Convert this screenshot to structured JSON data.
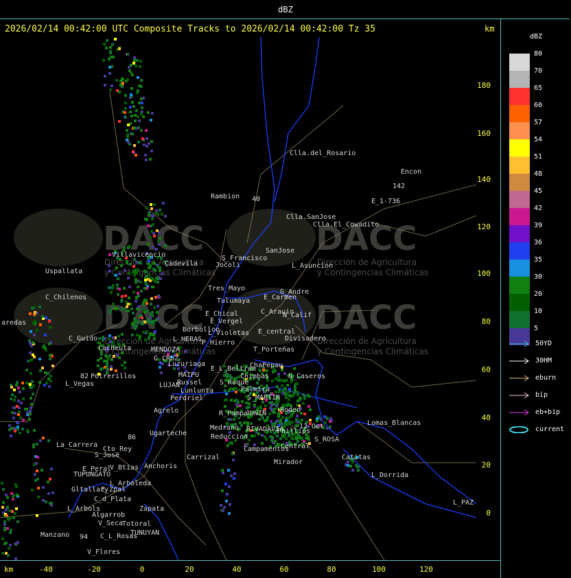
{
  "header": {
    "unit_label": "dBZ"
  },
  "title": "2026/02/14 00:42:00 UTC Composite Tracks to 2026/02/14 00:42:00 Tz 35",
  "axis": {
    "km_label_top": "km",
    "km_label_bottom": "km",
    "y_ticks": [
      "180",
      "160",
      "140",
      "120",
      "100",
      "80",
      "60",
      "40",
      "20",
      "0"
    ],
    "x_ticks": [
      "-40",
      "-20",
      "0",
      "20",
      "40",
      "60",
      "80",
      "100",
      "120"
    ]
  },
  "legend": {
    "title": "dBZ",
    "scale": [
      {
        "label": "80",
        "color": "#d8d8d8"
      },
      {
        "label": "70",
        "color": "#b4b4b4"
      },
      {
        "label": "65",
        "color": "#ff3030"
      },
      {
        "label": "60",
        "color": "#ff6000"
      },
      {
        "label": "57",
        "color": "#ff9050"
      },
      {
        "label": "54",
        "color": "#ffff00"
      },
      {
        "label": "51",
        "color": "#ffc030"
      },
      {
        "label": "48",
        "color": "#d08a40"
      },
      {
        "label": "45",
        "color": "#c06890"
      },
      {
        "label": "42",
        "color": "#cc1890"
      },
      {
        "label": "39",
        "color": "#7010c8"
      },
      {
        "label": "36",
        "color": "#2040f0"
      },
      {
        "label": "35",
        "color": "#1890e0"
      },
      {
        "label": "30",
        "color": "#108010"
      },
      {
        "label": "20",
        "color": "#006000"
      },
      {
        "label": "10",
        "color": "#107030"
      },
      {
        "label": "5",
        "color": "#483898"
      }
    ],
    "tracks": [
      {
        "label": "50YD",
        "color": "#40c8d0"
      },
      {
        "label": "30HM",
        "color": "#ffffff"
      },
      {
        "label": "eburn",
        "color": "#f0c080"
      },
      {
        "label": "bip",
        "color": "#f8c8d0"
      },
      {
        "label": "eb+bip",
        "color": "#e040e0"
      },
      {
        "label": "current",
        "color": "#40e0f0"
      }
    ]
  },
  "watermark": {
    "brand": "DACC",
    "line1": "Dirección de Agricultura",
    "line2": "y Contingencias Climáticas"
  },
  "places": [
    {
      "name": "Clla.del_Rosario"
    },
    {
      "name": "Encon"
    },
    {
      "name": "142"
    },
    {
      "name": "E_1-736"
    },
    {
      "name": "Rambion"
    },
    {
      "name": "Clla.SanJose"
    },
    {
      "name": "Clla.El_Cowadito"
    },
    {
      "name": "S_Francisco"
    },
    {
      "name": "SanJose"
    },
    {
      "name": "Villavicencio"
    },
    {
      "name": "Cadevila"
    },
    {
      "name": "Jocoli"
    },
    {
      "name": "L_Asuncion"
    },
    {
      "name": "Uspallata"
    },
    {
      "name": "Tres_Mayo"
    },
    {
      "name": "G_Andre"
    },
    {
      "name": "Tulumaya"
    },
    {
      "name": "E_Carmen"
    },
    {
      "name": "C_Chilenos"
    },
    {
      "name": "E_Chical"
    },
    {
      "name": "C_Arauio"
    },
    {
      "name": "N_Calif"
    },
    {
      "name": "E_Vergel"
    },
    {
      "name": "aredas"
    },
    {
      "name": "L_Violetas"
    },
    {
      "name": "E_central"
    },
    {
      "name": "Divisadero"
    },
    {
      "name": "Borbollon"
    },
    {
      "name": "C_Guido"
    },
    {
      "name": "L_HERAS"
    },
    {
      "name": "P_Hierro"
    },
    {
      "name": "Cacheuta"
    },
    {
      "name": "MENDOZA"
    },
    {
      "name": "T_Porteñas"
    },
    {
      "name": "G_CRUZ"
    },
    {
      "name": "Luzuriaga"
    },
    {
      "name": "E_L_Beltran"
    },
    {
      "name": "ChaPepau"
    },
    {
      "name": "Potrerillos"
    },
    {
      "name": "MAIPU"
    },
    {
      "name": "Chimbas"
    },
    {
      "name": "N_Caseros"
    },
    {
      "name": "L_Vegas"
    },
    {
      "name": "Russel"
    },
    {
      "name": "S_Roque"
    },
    {
      "name": "LUJAN"
    },
    {
      "name": "Lunlunta"
    },
    {
      "name": "Palmira"
    },
    {
      "name": "Perdriel"
    },
    {
      "name": "S_MARTIN"
    },
    {
      "name": "Agrelo"
    },
    {
      "name": "R_Pampa"
    },
    {
      "name": "JUNIN"
    },
    {
      "name": "Rodeo"
    },
    {
      "name": "Lomas_Blancas"
    },
    {
      "name": "Ugarteche"
    },
    {
      "name": "12_Oct"
    },
    {
      "name": "Medrano"
    },
    {
      "name": "RIVADAVIA"
    },
    {
      "name": "Phillips"
    },
    {
      "name": "Reduccion"
    },
    {
      "name": "S_ROSA"
    },
    {
      "name": "La_Carrera"
    },
    {
      "name": "Cto_Rey"
    },
    {
      "name": "Campamentos"
    },
    {
      "name": "Central"
    },
    {
      "name": "S_Jose"
    },
    {
      "name": "Carrizal"
    },
    {
      "name": "Catitas"
    },
    {
      "name": "V_Btias"
    },
    {
      "name": "Anchoris"
    },
    {
      "name": "Mirador"
    },
    {
      "name": "E_Peral"
    },
    {
      "name": "TUPUNGATO"
    },
    {
      "name": "L_Dorrida"
    },
    {
      "name": "L_Arboleda"
    },
    {
      "name": "Gltallary"
    },
    {
      "name": "E_Zpal"
    },
    {
      "name": "C_d_Plata"
    },
    {
      "name": "L_PAZ"
    },
    {
      "name": "L_Arbols"
    },
    {
      "name": "Zapata"
    },
    {
      "name": "Algarrob"
    },
    {
      "name": "V_Seca"
    },
    {
      "name": "Totoral"
    },
    {
      "name": "TUNUYAN"
    },
    {
      "name": "Manzano"
    },
    {
      "name": "C_L_Rosas"
    },
    {
      "name": "V_Flores"
    },
    {
      "name": "40"
    },
    {
      "name": "82"
    },
    {
      "name": "86"
    },
    {
      "name": "94"
    }
  ]
}
